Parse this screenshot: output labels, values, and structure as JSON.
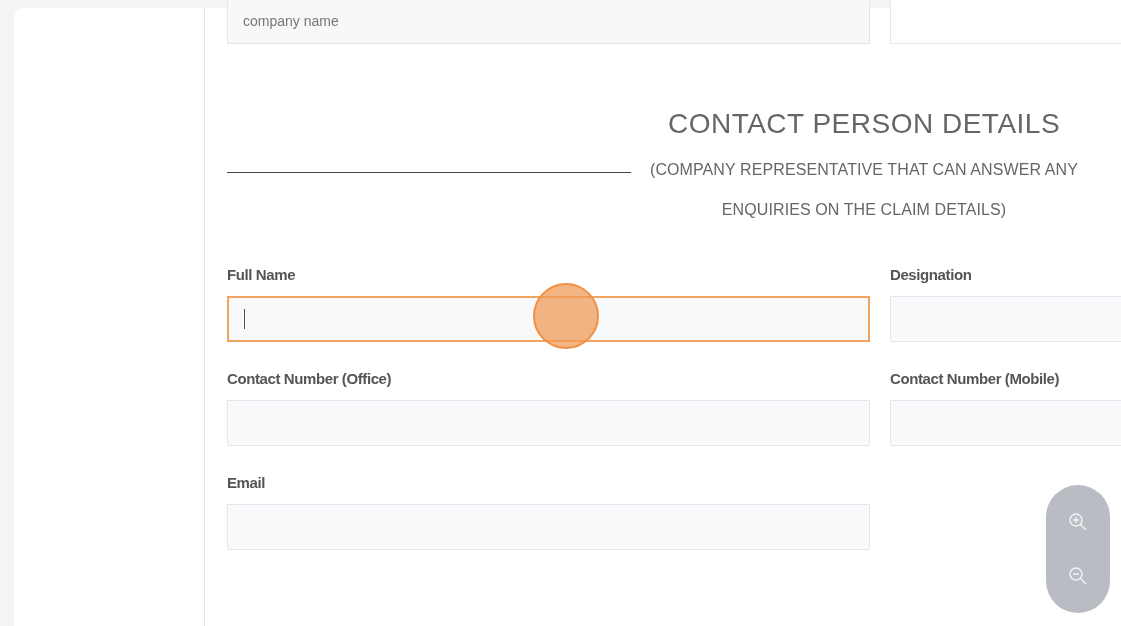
{
  "top_row": [
    {
      "placeholder": "company name",
      "focused": false
    },
    {
      "focused": false
    }
  ],
  "section": {
    "title": "CONTACT PERSON DETAILS",
    "subtitle": "(COMPANY REPRESENTATIVE THAT CAN ANSWER ANY ENQUIRIES ON THE CLAIM DETAILS)"
  },
  "fields": [
    {
      "label": "Full Name",
      "focused": true
    },
    {
      "label": "Designation",
      "focused": false
    },
    {
      "label": "Contact Number (Office)",
      "focused": false
    },
    {
      "label": "Contact Number (Mobile)",
      "focused": false
    },
    {
      "label": "Email",
      "focused": false
    }
  ]
}
